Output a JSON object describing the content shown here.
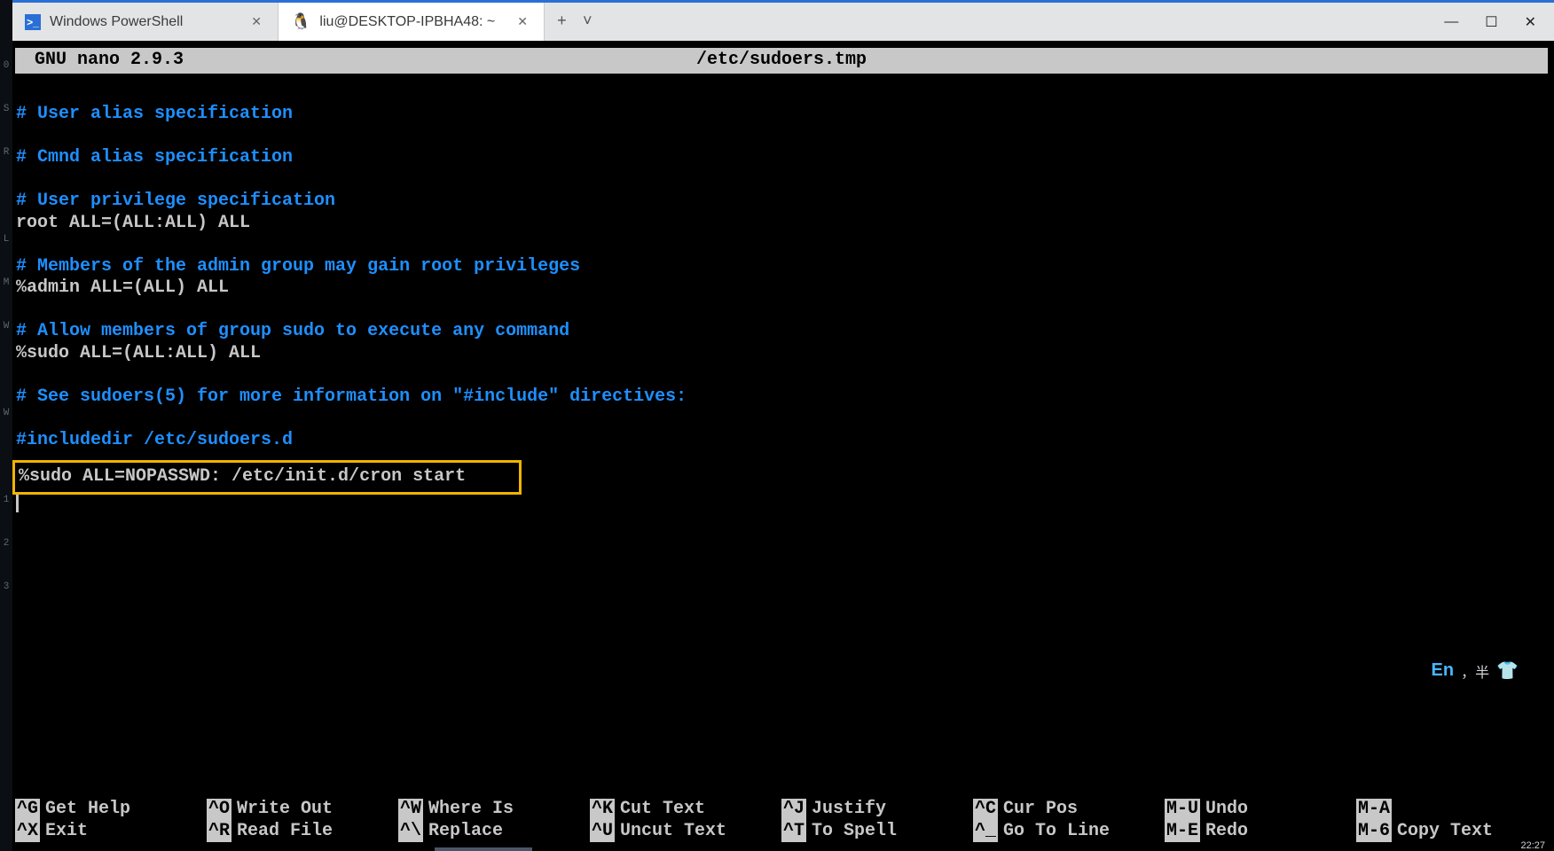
{
  "left_gutter": [
    "0",
    "S",
    "R",
    "",
    "L",
    "M",
    "W",
    "",
    "W",
    "",
    "1",
    "2",
    "3"
  ],
  "tabs": [
    {
      "title": "Windows PowerShell",
      "active": false,
      "icon": "ps"
    },
    {
      "title": "liu@DESKTOP-IPBHA48: ~",
      "active": true,
      "icon": "tux"
    }
  ],
  "title_extra": {
    "plus": "+",
    "chevron": "˅"
  },
  "win_controls": {
    "min": "—",
    "max": "☐",
    "close": "✕"
  },
  "nano": {
    "version": "GNU nano 2.9.3",
    "file": "/etc/sudoers.tmp",
    "body": {
      "l1": "# User alias specification",
      "l2": "# Cmnd alias specification",
      "l3": "# User privilege specification",
      "l4": "root    ALL=(ALL:ALL) ALL",
      "l5": "# Members of the admin group may gain root privileges",
      "l6": "%admin ALL=(ALL) ALL",
      "l7": "# Allow members of group sudo to execute any command",
      "l8": "%sudo   ALL=(ALL:ALL) ALL",
      "l9": "# See sudoers(5) for more information on \"#include\" directives:",
      "l10": "#includedir /etc/sudoers.d",
      "l11": "%sudo ALL=NOPASSWD: /etc/init.d/cron start"
    },
    "footer": [
      {
        "key": "^G",
        "label": "Get Help"
      },
      {
        "key": "^O",
        "label": "Write Out"
      },
      {
        "key": "^W",
        "label": "Where Is"
      },
      {
        "key": "^K",
        "label": "Cut Text"
      },
      {
        "key": "^J",
        "label": "Justify"
      },
      {
        "key": "^C",
        "label": "Cur Pos"
      },
      {
        "key": "M-U",
        "label": "Undo"
      },
      {
        "key": "M-A",
        "label": ""
      },
      {
        "key": "^X",
        "label": "Exit"
      },
      {
        "key": "^R",
        "label": "Read File"
      },
      {
        "key": "^\\",
        "label": "Replace"
      },
      {
        "key": "^U",
        "label": "Uncut Text"
      },
      {
        "key": "^T",
        "label": "To Spell"
      },
      {
        "key": "^_",
        "label": "Go To Line"
      },
      {
        "key": "M-E",
        "label": "Redo"
      },
      {
        "key": "M-6",
        "label": "Copy Text"
      }
    ]
  },
  "ime": {
    "en": "En",
    "mid": "，半",
    "shirt": "👕"
  },
  "clock": "22:27"
}
